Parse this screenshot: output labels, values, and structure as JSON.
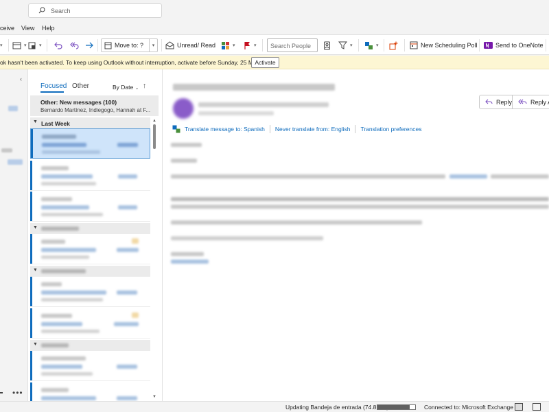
{
  "titlebar": {
    "search_placeholder": "Search"
  },
  "menu": {
    "items": [
      "ceive",
      "View",
      "Help"
    ]
  },
  "ribbon": {
    "move_to": "Move to: ?",
    "unread_read": "Unread/ Read",
    "search_people": "Search People",
    "new_scheduling_poll": "New Scheduling Poll",
    "send_to_onenote": "Send to OneNote"
  },
  "banner": {
    "message": "ok hasn't been activated. To keep using Outlook without interruption, activate before Sunday, 25 May 2025.",
    "activate_label": "Activate"
  },
  "message_list": {
    "tab_focused": "Focused",
    "tab_other": "Other",
    "sort_label": "By Date",
    "sort_arrow": "↑",
    "other_title": "Other: New messages (100)",
    "other_senders": "Bernardo Martínez, Indiegogo, Hannah at F...",
    "group_last_week": "Last Week"
  },
  "reading_pane": {
    "reply_label": "Reply",
    "reply_all_label": "Reply All",
    "translate_to": "Translate message to: Spanish",
    "never_translate": "Never translate from: English",
    "translation_prefs": "Translation preferences"
  },
  "statusbar": {
    "updating": "Updating Bandeja de entrada (74.8 MB).",
    "progress_fraction": 0.85,
    "connected": "Connected to: Microsoft Exchange"
  },
  "colors": {
    "accent": "#0f6cbd",
    "banner_bg": "#fdf6d3",
    "selected_bg": "#cfe4fa"
  }
}
